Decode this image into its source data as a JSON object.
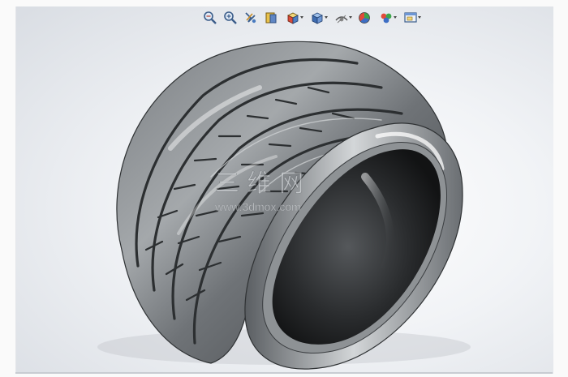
{
  "toolbar": {
    "buttons": [
      {
        "icon": "zoom-to-fit-icon"
      },
      {
        "icon": "zoom-to-area-icon"
      },
      {
        "icon": "previous-view-icon"
      },
      {
        "icon": "section-view-icon"
      },
      {
        "icon": "view-orientation-icon"
      },
      {
        "icon": "display-style-icon"
      },
      {
        "icon": "hide-show-items-icon"
      },
      {
        "icon": "edit-appearance-icon"
      },
      {
        "icon": "apply-scene-icon"
      },
      {
        "icon": "view-settings-icon"
      }
    ]
  },
  "watermark": {
    "line1": "三 维 网",
    "line2": "www.3dmox.com"
  },
  "colors": {
    "tire_dark": "#3a3d40",
    "tire_mid": "#6b6f73",
    "tire_light": "#c9ccce",
    "rim_inner": "#1f2123"
  }
}
